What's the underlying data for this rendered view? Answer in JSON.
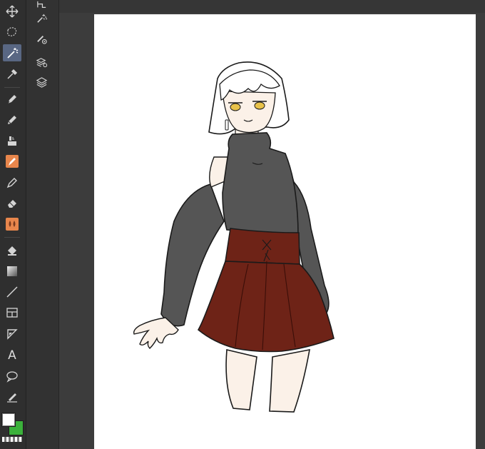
{
  "app": {
    "accent_color": "#596783",
    "tool_highlight_color": "#e8864c",
    "foreground_color": "#ffffff",
    "background_color": "#3bb13b"
  },
  "toolbar": {
    "tools": [
      {
        "name": "move-icon"
      },
      {
        "name": "lasso-selection-icon"
      },
      {
        "name": "magic-wand-icon",
        "active": true
      },
      {
        "name": "eyedropper-icon"
      },
      {
        "name": "pen-icon"
      },
      {
        "name": "pencil-icon"
      },
      {
        "name": "brush-icon"
      },
      {
        "name": "watercolor-brush-icon",
        "highlight": true
      },
      {
        "name": "airbrush-icon"
      },
      {
        "name": "eraser-icon"
      },
      {
        "name": "blend-icon",
        "highlight": true
      },
      {
        "name": "fill-bucket-icon"
      },
      {
        "name": "gradient-icon"
      },
      {
        "name": "line-figure-icon"
      },
      {
        "name": "frame-border-icon"
      },
      {
        "name": "ruler-icon"
      },
      {
        "name": "text-icon",
        "glyph": "A"
      },
      {
        "name": "balloon-icon"
      },
      {
        "name": "correct-line-icon"
      }
    ]
  },
  "subtool": {
    "items": [
      {
        "name": "select-layer-icon"
      },
      {
        "name": "auto-select-icon"
      },
      {
        "name": "brush-settings-icon"
      },
      {
        "name": "layer-stack-icon"
      },
      {
        "name": "layers-icon"
      }
    ]
  }
}
